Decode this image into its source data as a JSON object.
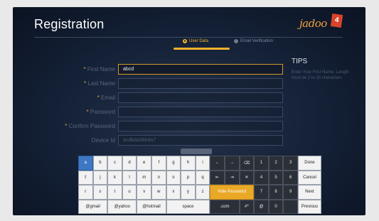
{
  "screen": {
    "title": "Registration",
    "logo_text": "jadoo",
    "logo_badge": "4"
  },
  "steps": [
    {
      "label": "User Data",
      "active": true
    },
    {
      "label": "Email Verification",
      "active": false
    }
  ],
  "form": {
    "required_mark": "*",
    "rows": [
      {
        "label": "First Name",
        "value": "abcd",
        "required": true
      },
      {
        "label": "Last Name",
        "value": "",
        "required": true
      },
      {
        "label": "Email",
        "value": "",
        "required": true
      },
      {
        "label": "Password",
        "value": "",
        "required": true
      },
      {
        "label": "Confirm Password",
        "value": "",
        "required": true
      },
      {
        "label": "Device Id",
        "value": "acdbda38eda7",
        "required": false
      }
    ]
  },
  "tips": {
    "title": "TIPS",
    "body": "Enter Your First Name. Length must be 2 to 20 characters"
  },
  "keyboard": {
    "letters": [
      "a",
      "b",
      "c",
      "d",
      "e",
      "f",
      "g",
      "h",
      "i",
      "j",
      "k",
      "l",
      "m",
      "n",
      "o",
      "p",
      "q",
      "r",
      "s",
      "t",
      "u",
      "v",
      "w",
      "x",
      "y",
      "z"
    ],
    "numbers": [
      "1",
      "2",
      "3",
      "4",
      "5",
      "6",
      "7",
      "8",
      "9",
      "0"
    ],
    "domains": [
      "@gmail",
      "@yahoo",
      "@hotmail"
    ],
    "space_label": "space",
    "hide_password_label": "Hide Password",
    "com_label": ".com",
    "hash_label": "#*",
    "at_label": "@",
    "done_label": "Done",
    "cancel_label": "Cancel",
    "next_label": "Next",
    "previous_label": "Previous"
  }
}
